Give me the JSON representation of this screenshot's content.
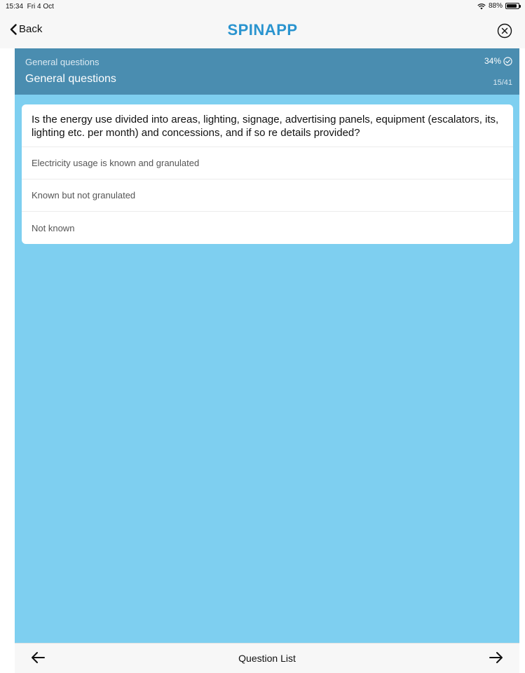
{
  "status_bar": {
    "time": "15:34",
    "date": "Fri 4 Oct",
    "battery": "88%",
    "battery_level": 0.88
  },
  "nav": {
    "back_label": "Back",
    "app_title": "SPINAPP"
  },
  "section": {
    "category": "General questions",
    "title": "General questions",
    "progress_percent": "34%",
    "progress_count": "15/41"
  },
  "question": {
    "text": "Is the energy use divided into areas, lighting, signage, advertising panels, equipment (escalators, its, lighting etc. per month) and concessions, and if so re details provided?",
    "options": [
      "Electricity usage is known and granulated",
      "Known but not granulated",
      "Not known"
    ]
  },
  "footer": {
    "question_list_label": "Question List"
  },
  "colors": {
    "brand": "#2a94cf",
    "section_header": "#4a8db0",
    "content_bg": "#7ecff0"
  },
  "icons": {
    "back": "chevron-left-icon",
    "close": "close-circle-icon",
    "progress": "check-circle-icon",
    "prev": "arrow-left-icon",
    "next": "arrow-right-icon",
    "wifi": "wifi-icon",
    "battery": "battery-icon"
  }
}
